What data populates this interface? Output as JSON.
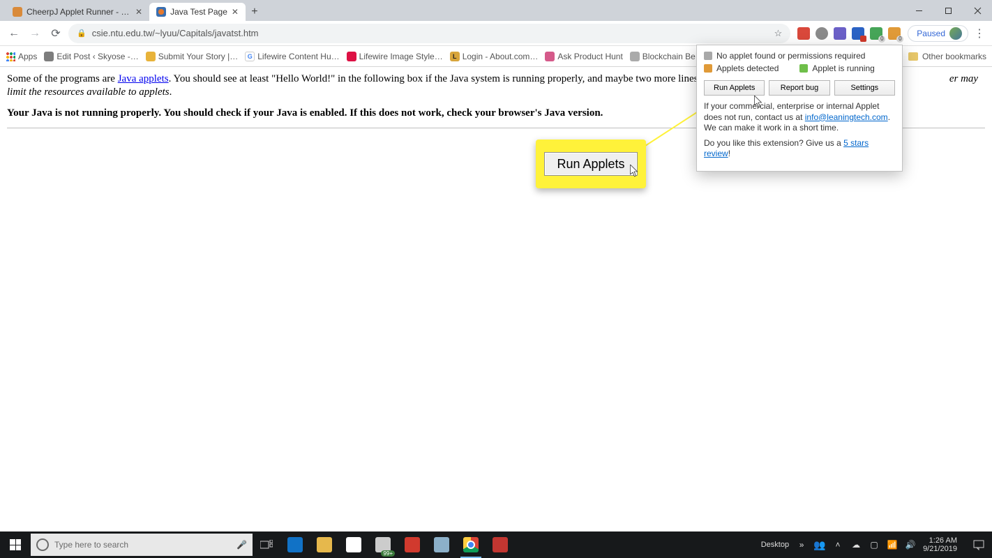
{
  "tabs": [
    {
      "title": "CheerpJ Applet Runner - Chrome",
      "active": false
    },
    {
      "title": "Java Test Page",
      "active": true
    }
  ],
  "url": "csie.ntu.edu.tw/~lyuu/Capitals/javatst.htm",
  "paused": "Paused",
  "bookmarks_apps": "Apps",
  "bookmarks": [
    "Edit Post ‹ Skyose -…",
    "Submit Your Story |…",
    "Lifewire Content Hu…",
    "Lifewire Image Style…",
    "Login - About.com…",
    "Ask Product Hunt",
    "Blockchain Be"
  ],
  "other_bookmarks": "Other bookmarks",
  "page": {
    "p1_a": "Some of the programs are ",
    "p1_link": "Java applets",
    "p1_b": ". You should see at least \"Hello World!\" in the following box if the Java system is running properly, and maybe two more lines i",
    "p1_c": "er may limit the resources available to applets",
    "p1_dot": ".",
    "p2": "Your Java is not running properly. You should check if your Java is enabled. If this does not work, check your browser's Java version."
  },
  "highlight_btn": "Run Applets",
  "ext_popup": {
    "no_applet": "No applet found or permissions required",
    "detected": "Applets detected",
    "running": "Applet is running",
    "btn_run": "Run Applets",
    "btn_bug": "Report bug",
    "btn_settings": "Settings",
    "msg1_a": "If your commercial, enterprise or internal Applet does not run, contact us at ",
    "msg1_link": "info@leaningtech.com",
    "msg1_b": ". We can make it work in a short time.",
    "msg2_a": "Do you like this extension? Give us a ",
    "msg2_link": "5 stars review",
    "msg2_b": "!"
  },
  "taskbar": {
    "search_placeholder": "Type here to search",
    "mail_badge": "99+",
    "desktop": "Desktop",
    "time": "1:26 AM",
    "date": "9/21/2019"
  }
}
